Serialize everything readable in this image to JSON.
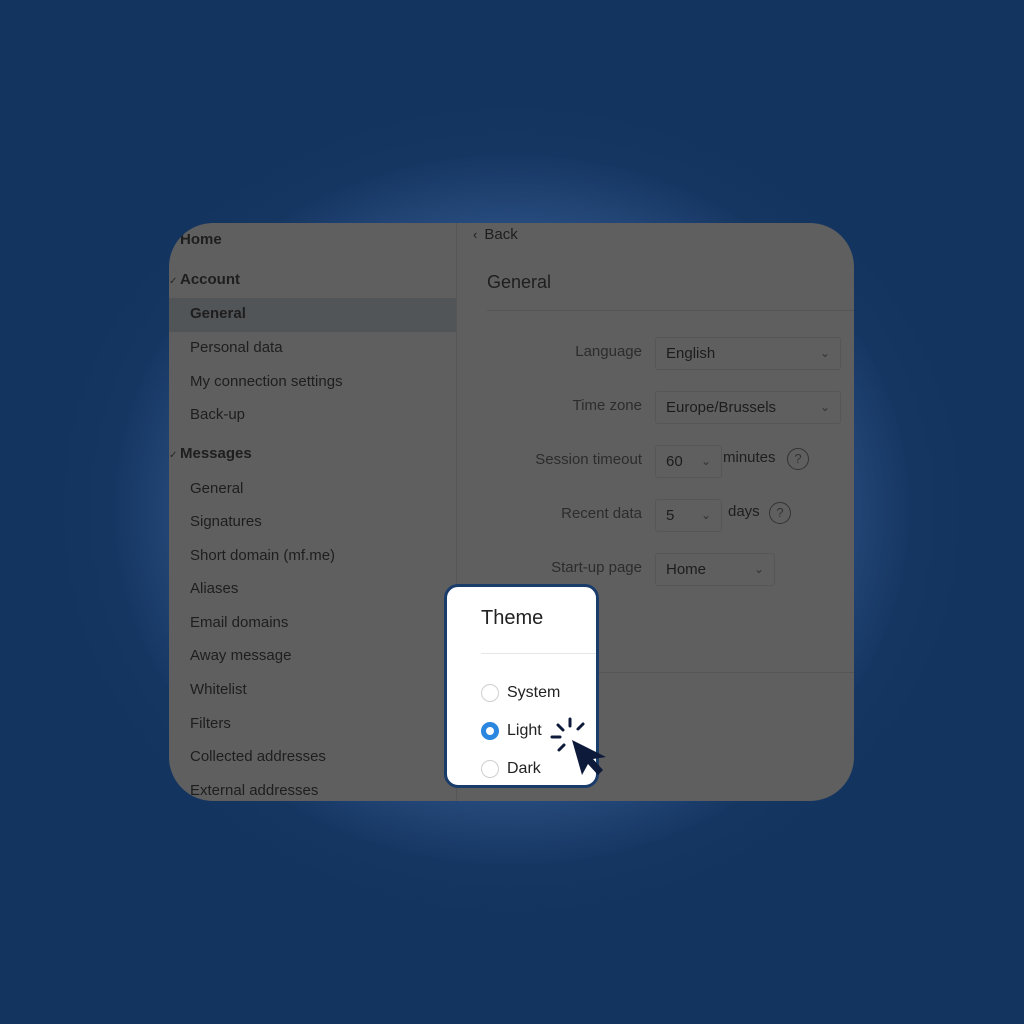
{
  "sidebar": {
    "home": "Home",
    "sections": [
      {
        "label": "Account",
        "expanded_icon": "✓",
        "items": [
          "General",
          "Personal data",
          "My connection settings",
          "Back-up"
        ],
        "active_index": 0
      },
      {
        "label": "Messages",
        "expanded_icon": "✓",
        "items": [
          "General",
          "Signatures",
          "Short domain (mf.me)",
          "Aliases",
          "Email domains",
          "Away message",
          "Whitelist",
          "Filters",
          "Collected addresses",
          "External addresses"
        ]
      }
    ]
  },
  "main": {
    "back_icon": "‹",
    "back_label": "Back",
    "title": "General",
    "fields": {
      "language": {
        "label": "Language",
        "value": "English"
      },
      "timezone": {
        "label": "Time zone",
        "value": "Europe/Brussels"
      },
      "session_timeout": {
        "label": "Session timeout",
        "value": "60",
        "unit": "minutes",
        "help": "?"
      },
      "recent_data": {
        "label": "Recent data",
        "value": "5",
        "unit": "days",
        "help": "?"
      },
      "startup_page": {
        "label": "Start-up page",
        "value": "Home"
      }
    },
    "dropdown_arrow": "⌄"
  },
  "theme_popup": {
    "title": "Theme",
    "options": [
      "System",
      "Light",
      "Dark"
    ],
    "selected": "Light"
  },
  "colors": {
    "background": "#143460",
    "accent_radio": "#2b86e0",
    "popup_border": "#1a3c6a",
    "cursor": "#0d1a3a"
  }
}
